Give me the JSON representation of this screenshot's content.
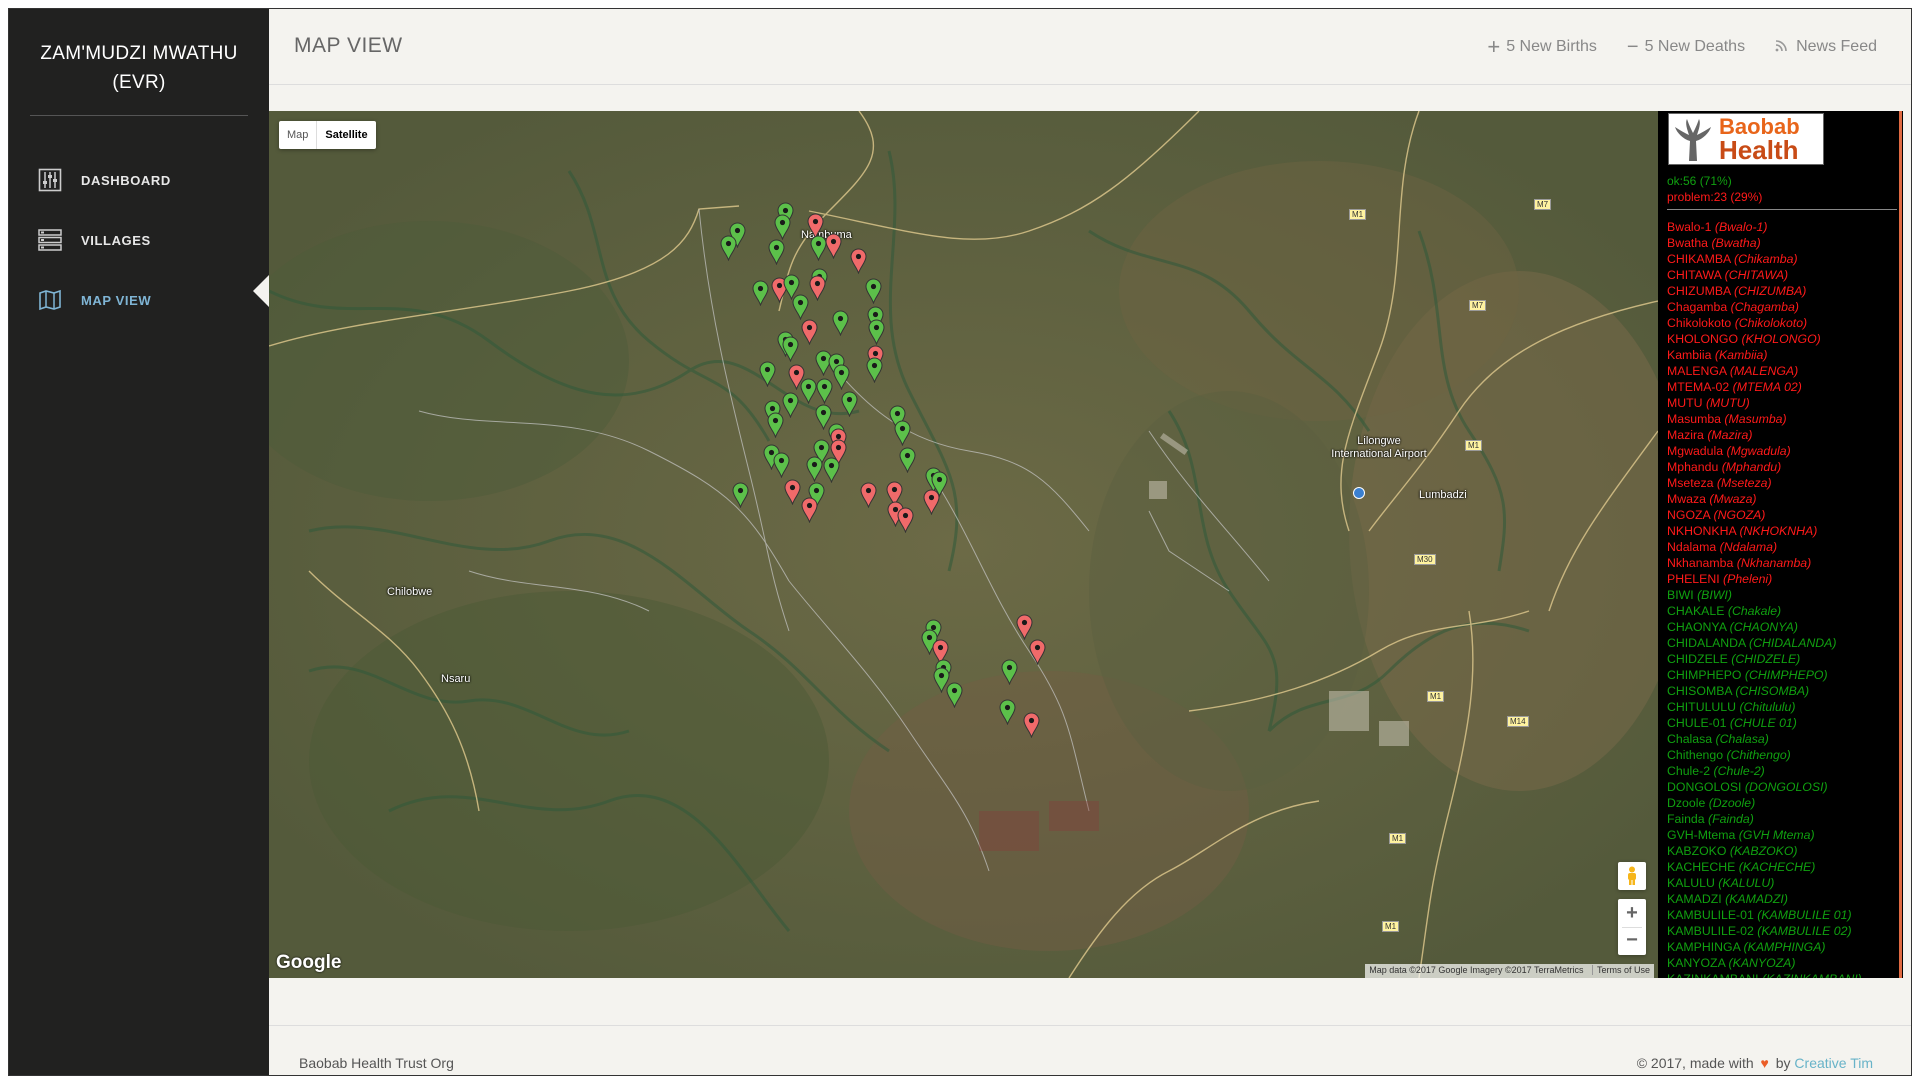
{
  "sidebar": {
    "brand": "ZAM'MUDZI MWATHU (EVR)",
    "items": [
      {
        "label": "DASHBOARD",
        "icon": "sliders-icon"
      },
      {
        "label": "VILLAGES",
        "icon": "list-icon"
      },
      {
        "label": "MAP VIEW",
        "icon": "map-icon",
        "active": true
      }
    ]
  },
  "header": {
    "title": "MAP VIEW",
    "births": "5 New Births",
    "deaths": "5 New Deaths",
    "news": "News Feed"
  },
  "map": {
    "types": [
      "Map",
      "Satellite"
    ],
    "selected_type": "Satellite",
    "labels": [
      "Nambuma",
      "Lilongwe International Airport",
      "Lumbadzi",
      "Chilobwe",
      "Nsaru"
    ],
    "roads": [
      "M1",
      "M7",
      "M30",
      "M14"
    ],
    "google": "Google",
    "attribution": "Map data ©2017 Google Imagery ©2017 TerraMetrics",
    "terms": "Terms of Use",
    "zoom_in": "+",
    "zoom_out": "−",
    "ok_color": "#5cc04a",
    "problem_color": "#f06a6a"
  },
  "legend": {
    "logo_top": "Baobab",
    "logo_bottom": "Health",
    "ok_summary": "ok:56 (71%)",
    "problem_summary": "problem:23 (29%)",
    "villages": [
      {
        "name": "Bwalo-1",
        "alt": "(Bwalo-1)",
        "status": "problem"
      },
      {
        "name": "Bwatha",
        "alt": "(Bwatha)",
        "status": "problem"
      },
      {
        "name": "CHIKAMBA",
        "alt": "(Chikamba)",
        "status": "problem"
      },
      {
        "name": "CHITAWA",
        "alt": "(CHITAWA)",
        "status": "problem"
      },
      {
        "name": "CHIZUMBA",
        "alt": "(CHIZUMBA)",
        "status": "problem"
      },
      {
        "name": "Chagamba",
        "alt": "(Chagamba)",
        "status": "problem"
      },
      {
        "name": "Chikolokoto",
        "alt": "(Chikolokoto)",
        "status": "problem"
      },
      {
        "name": "KHOLONGO",
        "alt": "(KHOLONGO)",
        "status": "problem"
      },
      {
        "name": "Kambiia",
        "alt": "(Kambiia)",
        "status": "problem"
      },
      {
        "name": "MALENGA",
        "alt": "(MALENGA)",
        "status": "problem"
      },
      {
        "name": "MTEMA-02",
        "alt": "(MTEMA 02)",
        "status": "problem"
      },
      {
        "name": "MUTU",
        "alt": "(MUTU)",
        "status": "problem"
      },
      {
        "name": "Masumba",
        "alt": "(Masumba)",
        "status": "problem"
      },
      {
        "name": "Mazira",
        "alt": "(Mazira)",
        "status": "problem"
      },
      {
        "name": "Mgwadula",
        "alt": "(Mgwadula)",
        "status": "problem"
      },
      {
        "name": "Mphandu",
        "alt": "(Mphandu)",
        "status": "problem"
      },
      {
        "name": "Mseteza",
        "alt": "(Mseteza)",
        "status": "problem"
      },
      {
        "name": "Mwaza",
        "alt": "(Mwaza)",
        "status": "problem"
      },
      {
        "name": "NGOZA",
        "alt": "(NGOZA)",
        "status": "problem"
      },
      {
        "name": "NKHONKHA",
        "alt": "(NKHOKNHA)",
        "status": "problem"
      },
      {
        "name": "Ndalama",
        "alt": "(Ndalama)",
        "status": "problem"
      },
      {
        "name": "Nkhanamba",
        "alt": "(Nkhanamba)",
        "status": "problem"
      },
      {
        "name": "PHELENI",
        "alt": "(Pheleni)",
        "status": "problem"
      },
      {
        "name": "BIWI",
        "alt": "(BIWI)",
        "status": "ok"
      },
      {
        "name": "CHAKALE",
        "alt": "(Chakale)",
        "status": "ok"
      },
      {
        "name": "CHAONYA",
        "alt": "(CHAONYA)",
        "status": "ok"
      },
      {
        "name": "CHIDALANDA",
        "alt": "(CHIDALANDA)",
        "status": "ok"
      },
      {
        "name": "CHIDZELE",
        "alt": "(CHIDZELE)",
        "status": "ok"
      },
      {
        "name": "CHIMPHEPO",
        "alt": "(CHIMPHEPO)",
        "status": "ok"
      },
      {
        "name": "CHISOMBA",
        "alt": "(CHISOMBA)",
        "status": "ok"
      },
      {
        "name": "CHITULULU",
        "alt": "(Chitululu)",
        "status": "ok"
      },
      {
        "name": "CHULE-01",
        "alt": "(CHULE 01)",
        "status": "ok"
      },
      {
        "name": "Chalasa",
        "alt": "(Chalasa)",
        "status": "ok"
      },
      {
        "name": "Chithengo",
        "alt": "(Chithengo)",
        "status": "ok"
      },
      {
        "name": "Chule-2",
        "alt": "(Chule-2)",
        "status": "ok"
      },
      {
        "name": "DONGOLOSI",
        "alt": "(DONGOLOSI)",
        "status": "ok"
      },
      {
        "name": "Dzoole",
        "alt": "(Dzoole)",
        "status": "ok"
      },
      {
        "name": "Fainda",
        "alt": "(Fainda)",
        "status": "ok"
      },
      {
        "name": "GVH-Mtema",
        "alt": "(GVH Mtema)",
        "status": "ok"
      },
      {
        "name": "KABZOKO",
        "alt": "(KABZOKO)",
        "status": "ok"
      },
      {
        "name": "KACHECHE",
        "alt": "(KACHECHE)",
        "status": "ok"
      },
      {
        "name": "KALULU",
        "alt": "(KALULU)",
        "status": "ok"
      },
      {
        "name": "KAMADZI",
        "alt": "(KAMADZI)",
        "status": "ok"
      },
      {
        "name": "KAMBULILE-01",
        "alt": "(KAMBULILE 01)",
        "status": "ok"
      },
      {
        "name": "KAMBULILE-02",
        "alt": "(KAMBULILE 02)",
        "status": "ok"
      },
      {
        "name": "KAMPHINGA",
        "alt": "(KAMPHINGA)",
        "status": "ok"
      },
      {
        "name": "KANYOZA",
        "alt": "(KANYOZA)",
        "status": "ok"
      },
      {
        "name": "KAZINKAMBANI",
        "alt": "(KAZINKAMBANI)",
        "status": "ok"
      }
    ]
  },
  "footer": {
    "left": "Baobab Health Trust Org",
    "right_prefix": "© 2017, made with",
    "by": "by",
    "author": "Creative Tim"
  }
}
